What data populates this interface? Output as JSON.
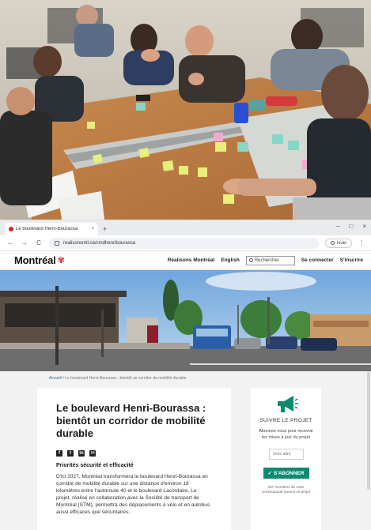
{
  "browser": {
    "tab_title": "Le boulevard Henri-Bourassa",
    "tab_close": "×",
    "new_tab": "+",
    "window_controls": [
      "–",
      "□",
      "×"
    ],
    "nav": {
      "back": "←",
      "forward": "→",
      "reload": "C"
    },
    "url": "realisonsmtl.ca/cmdhenribourassa",
    "guest_label": "Invité"
  },
  "site": {
    "logo_text": "Montréal",
    "nav": {
      "realisons": "Réalisons Montréal",
      "language": "English",
      "search_placeholder": "Rechercher",
      "login": "Se connecter",
      "signup": "S'inscrire"
    }
  },
  "breadcrumb": {
    "home": "Accueil",
    "separator": " / ",
    "current": "Le boulevard Henri-Bourassa : bientôt un corridor de mobilité durable"
  },
  "article": {
    "title": "Le boulevard Henri-Bourassa : bientôt un corridor de mobilité durable",
    "share_icons": [
      "facebook-icon",
      "twitter-icon",
      "linkedin-icon",
      "email-icon"
    ],
    "section_heading": "Priorités sécurité et efficacité",
    "body": "D'ici 2027, Montréal transformera le boulevard Henri-Bourassa en corridor de mobilité durable sur une distance d'environ 18 kilomètres entre l'autoroute 40 et le boulevard Lacordaire. Le projet, réalisé en collaboration avec la Société de transport de Montréal (STM), permettra des déplacements à vélo et en autobus aussi efficaces que sécuritaires."
  },
  "follow": {
    "title": "SUIVRE LE PROJET",
    "description": "Abonnez-vous pour recevoir les mises à jour du projet",
    "email_placeholder": "Votre adre",
    "subscribe_label": "S'ABONNER",
    "members_note": "357 membres de votre communauté suivent ce projet"
  },
  "colors": {
    "brand_red": "#d5212e",
    "subscribe_green": "#0c8b6f",
    "link_blue": "#2e6da4"
  }
}
